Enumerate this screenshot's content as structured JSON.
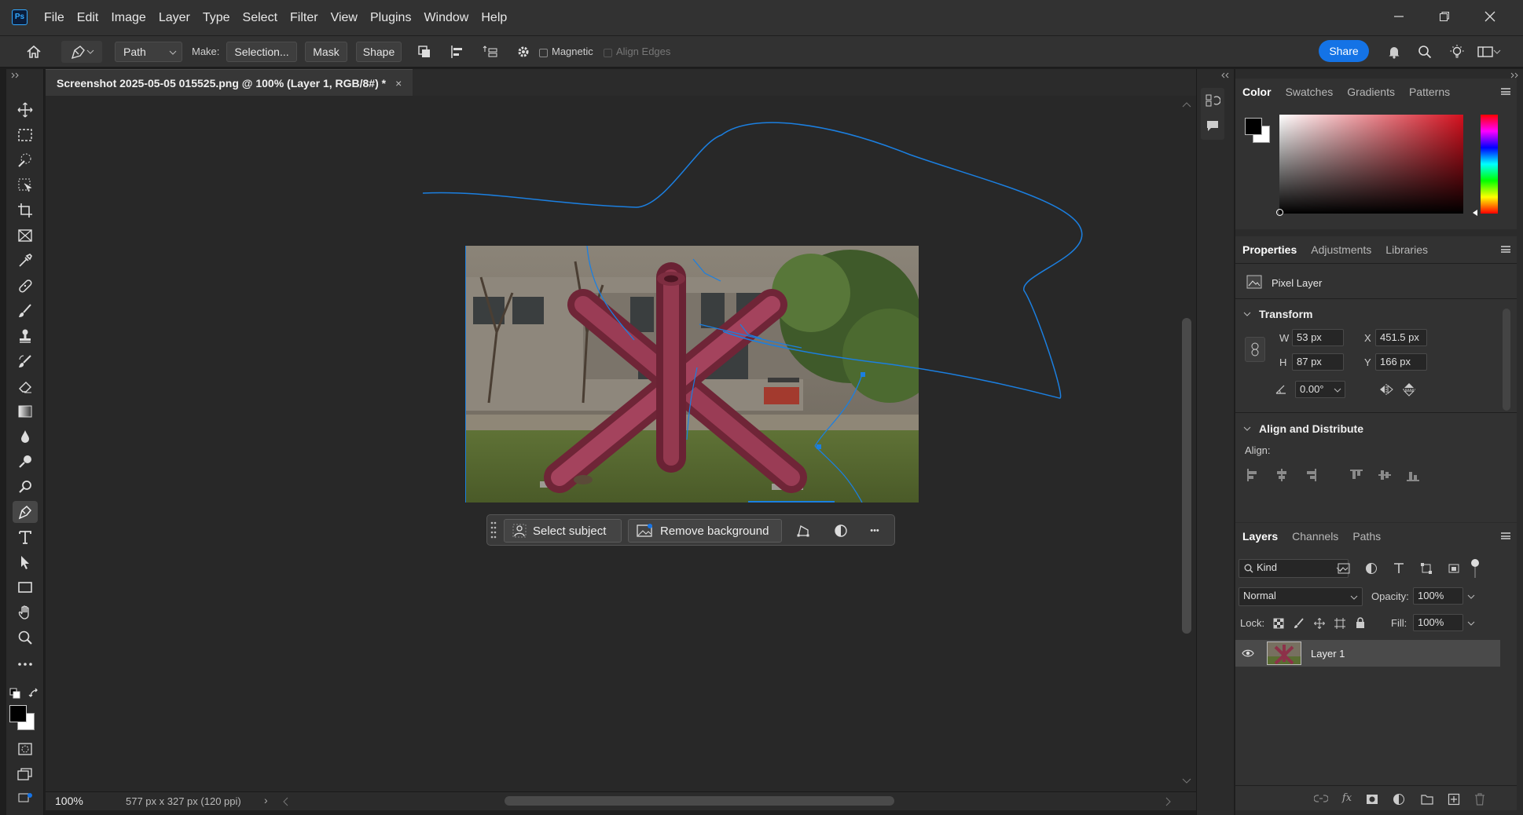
{
  "app": {
    "logo_text": "Ps",
    "menus": [
      "File",
      "Edit",
      "Image",
      "Layer",
      "Type",
      "Select",
      "Filter",
      "View",
      "Plugins",
      "Window",
      "Help"
    ]
  },
  "options_bar": {
    "mode_select": "Path",
    "make_label": "Make:",
    "selection_button": "Selection...",
    "mask_button": "Mask",
    "shape_button": "Shape",
    "magnetic_label": "Magnetic",
    "align_edges_label": "Align Edges",
    "share_button": "Share"
  },
  "document": {
    "tab_title": "Screenshot 2025-05-05 015525.png @ 100% (Layer 1, RGB/8#) *",
    "close_glyph": "×"
  },
  "taskbar": {
    "select_subject": "Select subject",
    "remove_background": "Remove background",
    "more_glyph": "•••"
  },
  "status_bar": {
    "zoom": "100%",
    "doc_info": "577 px x 327 px (120 ppi)",
    "arrow": "›"
  },
  "color_panel": {
    "tabs": [
      "Color",
      "Swatches",
      "Gradients",
      "Patterns"
    ],
    "active_tab": "Color",
    "foreground_color": "#000000",
    "background_color": "#ffffff",
    "hue_color": "#d4101e"
  },
  "properties_panel": {
    "tabs": [
      "Properties",
      "Adjustments",
      "Libraries"
    ],
    "active_tab": "Properties",
    "layer_type": "Pixel Layer",
    "transform_title": "Transform",
    "w_label": "W",
    "w_value": "53 px",
    "h_label": "H",
    "h_value": "87 px",
    "x_label": "X",
    "x_value": "451.5 px",
    "y_label": "Y",
    "y_value": "166 px",
    "angle_value": "0.00°",
    "align_title": "Align and Distribute",
    "align_label": "Align:"
  },
  "layers_panel": {
    "tabs": [
      "Layers",
      "Channels",
      "Paths"
    ],
    "active_tab": "Layers",
    "filter_kind": "Kind",
    "blend_mode": "Normal",
    "opacity_label": "Opacity:",
    "opacity_value": "100%",
    "lock_label": "Lock:",
    "fill_label": "Fill:",
    "fill_value": "100%",
    "layers": [
      {
        "name": "Layer 1",
        "visible": true,
        "selected": true
      }
    ]
  },
  "colors": {
    "accent": "#1473e6",
    "path_stroke": "#1b7fe0",
    "sculpture": "#8a2f45"
  }
}
